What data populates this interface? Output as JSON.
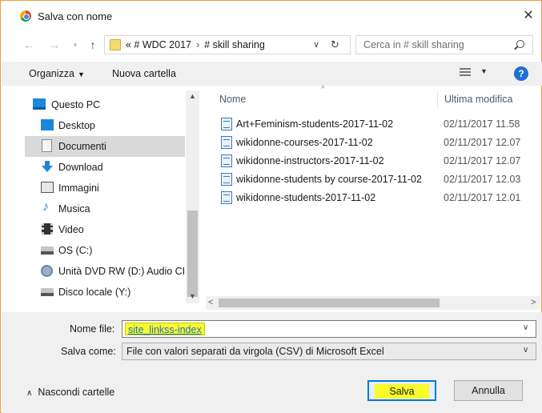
{
  "window": {
    "title": "Salva con nome",
    "close_icon": "close-icon"
  },
  "address": {
    "crumbs": [
      "« # WDC 2017",
      "# skill sharing"
    ],
    "separator": "›",
    "search_placeholder": "Cerca in # skill sharing"
  },
  "toolbar": {
    "organize": "Organizza",
    "new_folder": "Nuova cartella",
    "help": "?"
  },
  "nav": {
    "items": [
      {
        "label": "Questo PC",
        "icon": "pc-icon"
      },
      {
        "label": "Desktop",
        "icon": "desktop-icon"
      },
      {
        "label": "Documenti",
        "icon": "documents-icon",
        "selected": true
      },
      {
        "label": "Download",
        "icon": "download-icon"
      },
      {
        "label": "Immagini",
        "icon": "images-icon"
      },
      {
        "label": "Musica",
        "icon": "music-icon"
      },
      {
        "label": "Video",
        "icon": "video-icon"
      },
      {
        "label": "OS (C:)",
        "icon": "drive-icon"
      },
      {
        "label": "Unità DVD RW (D:) Audio CI",
        "icon": "dvd-icon"
      },
      {
        "label": "Disco locale (Y:)",
        "icon": "drive-icon"
      }
    ]
  },
  "files": {
    "columns": {
      "name": "Nome",
      "modified": "Ultima modifica"
    },
    "rows": [
      {
        "name": "Art+Feminism-students-2017-11-02",
        "modified": "02/11/2017 11.58"
      },
      {
        "name": "wikidonne-courses-2017-11-02",
        "modified": "02/11/2017 12.07"
      },
      {
        "name": "wikidonne-instructors-2017-11-02",
        "modified": "02/11/2017 12.07"
      },
      {
        "name": "wikidonne-students by course-2017-11-02",
        "modified": "02/11/2017 12.03"
      },
      {
        "name": "wikidonne-students-2017-11-02",
        "modified": "02/11/2017 12.01"
      }
    ]
  },
  "form": {
    "filename_label": "Nome file:",
    "filename_value": "site_linkss-index",
    "saveas_label": "Salva come:",
    "saveas_value": "File con valori separati da virgola (CSV) di Microsoft Excel",
    "highlight_color": "#f9fb2a"
  },
  "footer": {
    "hide_folders": "Nascondi cartelle",
    "save": "Salva",
    "cancel": "Annulla"
  }
}
